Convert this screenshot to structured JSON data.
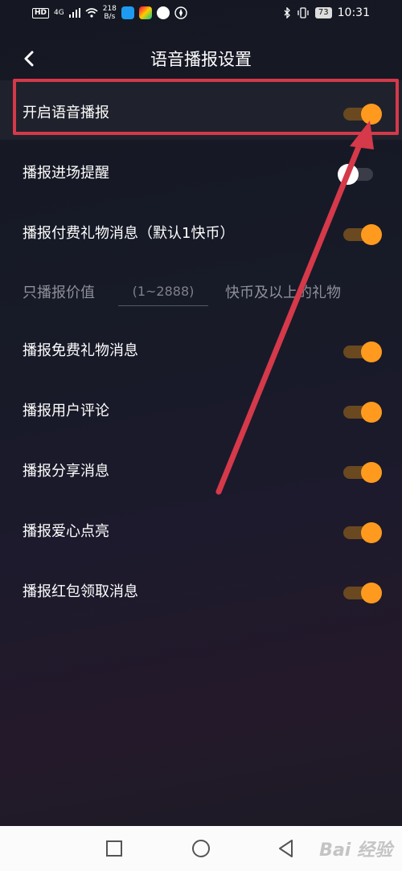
{
  "status_bar": {
    "network": "HD",
    "signal_label": "4G",
    "speed_value": "218",
    "speed_unit": "B/s",
    "battery": "73",
    "time": "10:31"
  },
  "header": {
    "title": "语音播报设置"
  },
  "settings": [
    {
      "label": "开启语音播报",
      "on": true
    },
    {
      "label": "播报进场提醒",
      "on": false
    },
    {
      "label": "播报付费礼物消息（默认1快币）",
      "on": true
    },
    {
      "label": "播报免费礼物消息",
      "on": true
    },
    {
      "label": "播报用户评论",
      "on": true
    },
    {
      "label": "播报分享消息",
      "on": true
    },
    {
      "label": "播报爱心点亮",
      "on": true
    },
    {
      "label": "播报红包领取消息",
      "on": true
    }
  ],
  "value_filter": {
    "label": "只播报价值",
    "placeholder": "(1~2888)",
    "suffix": "快币及以上的礼物"
  },
  "watermark": "Bai 经验",
  "colors": {
    "accent_on": "#ff9a1f",
    "annotation_red": "#d5394a"
  }
}
